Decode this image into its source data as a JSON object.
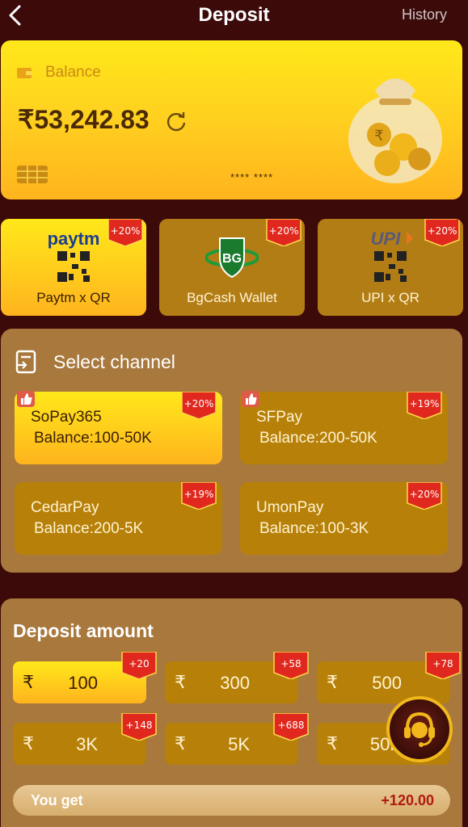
{
  "header": {
    "title": "Deposit",
    "history": "History"
  },
  "balance": {
    "label": "Balance",
    "amount": "₹53,242.83",
    "card_mask": "**** ****"
  },
  "methods": [
    {
      "label": "Paytm x QR",
      "badge": "+20%"
    },
    {
      "label": "BgCash Wallet",
      "badge": "+20%"
    },
    {
      "label": "UPI x QR",
      "badge": "+20%"
    }
  ],
  "channel": {
    "title": "Select channel",
    "items": [
      {
        "name": "SoPay365",
        "balance": "Balance:100-50K",
        "badge": "+20%"
      },
      {
        "name": "SFPay",
        "balance": "Balance:200-50K",
        "badge": "+19%"
      },
      {
        "name": "CedarPay",
        "balance": "Balance:200-5K",
        "badge": "+19%"
      },
      {
        "name": "UmonPay",
        "balance": "Balance:100-3K",
        "badge": "+20%"
      }
    ]
  },
  "deposit": {
    "title": "Deposit amount",
    "currency": "₹",
    "amounts": [
      {
        "value": "100",
        "bonus": "+20"
      },
      {
        "value": "300",
        "bonus": "+58"
      },
      {
        "value": "500",
        "bonus": "+78"
      },
      {
        "value": "3K",
        "bonus": "+148"
      },
      {
        "value": "5K",
        "bonus": "+688"
      },
      {
        "value": "50K",
        "bonus": ""
      }
    ],
    "you_get_label": "You get",
    "you_get_value": "+120.00"
  },
  "colors": {
    "accent": "#ffd21f",
    "panel": "#a8783c",
    "bg": "#3d0a0a",
    "badge": "#e0281e"
  },
  "icons": [
    "back-arrow-icon",
    "wallet-icon",
    "refresh-icon",
    "card-chip-icon",
    "money-bag-icon",
    "qr-code-icon",
    "select-channel-icon",
    "thumbs-up-icon",
    "customer-support-icon"
  ]
}
